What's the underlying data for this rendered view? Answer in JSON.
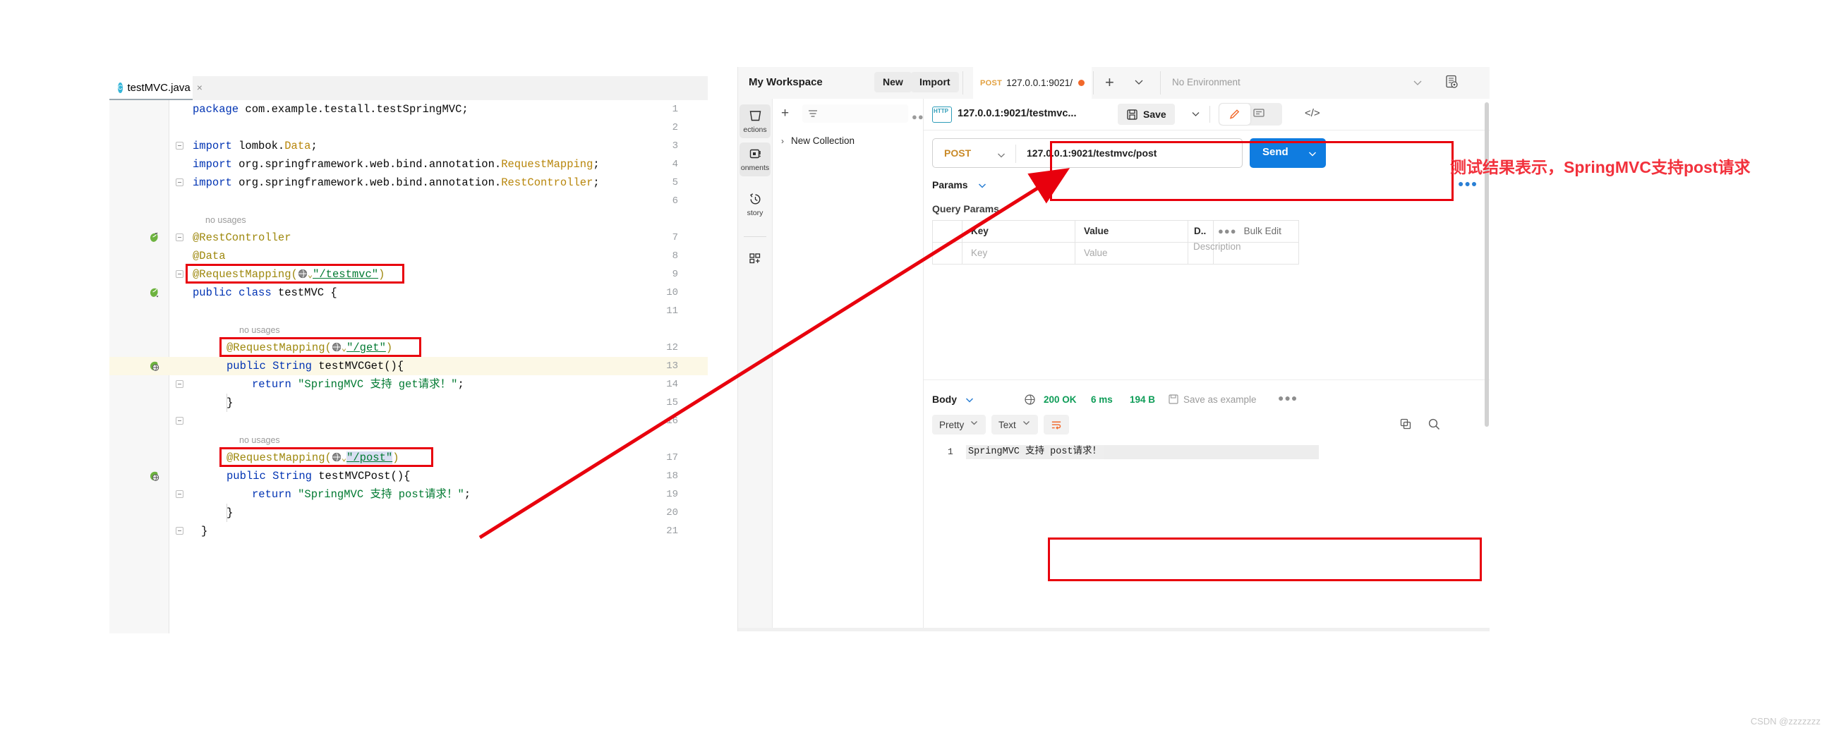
{
  "ide": {
    "tab": {
      "label": "testMVC.java",
      "icon": "java-class-icon",
      "close": "×"
    },
    "lines": [
      {
        "n": "1"
      },
      {
        "n": "2"
      },
      {
        "n": "3"
      },
      {
        "n": "4"
      },
      {
        "n": "5"
      },
      {
        "n": "6"
      },
      {
        "n": "7"
      },
      {
        "n": "8"
      },
      {
        "n": "9"
      },
      {
        "n": "10"
      },
      {
        "n": "11"
      },
      {
        "n": "12"
      },
      {
        "n": "13"
      },
      {
        "n": "14"
      },
      {
        "n": "15"
      },
      {
        "n": "16"
      },
      {
        "n": "17"
      },
      {
        "n": "18"
      },
      {
        "n": "19"
      },
      {
        "n": "20"
      },
      {
        "n": "21"
      }
    ],
    "code": {
      "l1_kw": "package",
      "l1_rest": " com.example.testall.testSpringMVC;",
      "l3_kw": "import",
      "l3_pkg": " lombok.",
      "l3_cls": "Data",
      "l3_end": ";",
      "l4_kw": "import",
      "l4_pkg": " org.springframework.web.bind.annotation.",
      "l4_cls": "RequestMapping",
      "l4_end": ";",
      "l5_kw": "import",
      "l5_pkg": " org.springframework.web.bind.annotation.",
      "l5_cls": "RestController",
      "l5_end": ";",
      "l7": "@RestController",
      "l8": "@Data",
      "l9_a": "@RequestMapping(",
      "l9_str": "\"/testmvc\"",
      "l9_b": ")",
      "l10_kw1": "public",
      "l10_kw2": "class",
      "l10_name": " testMVC {",
      "l12_a": "@RequestMapping(",
      "l12_str": "\"/get\"",
      "l12_b": ")",
      "l13_kw1": "public",
      "l13_kw2": "String",
      "l13_name": " testMVCGet(){",
      "l14_kw": "return",
      "l14_str": "\"SpringMVC 支持 get请求！\"",
      "l14_end": ";",
      "l15": "}",
      "l17_a": "@RequestMapping(",
      "l17_str": "\"/post\"",
      "l17_b": ")",
      "l18_kw1": "public",
      "l18_kw2": "String",
      "l18_name": " testMVCPost(){",
      "l19_kw": "return",
      "l19_str": "\"SpringMVC 支持 post请求！\"",
      "l19_end": ";",
      "l20": "}",
      "l21": "}",
      "no_usages": "no usages"
    }
  },
  "postman": {
    "workspace": "My Workspace",
    "new_button": "New",
    "import_button": "Import",
    "request_tab": {
      "method": "POST",
      "title": "127.0.0.1:9021/",
      "unsaved": true
    },
    "environment": "No Environment",
    "nav": [
      {
        "label": "ections",
        "icon": "collections-icon",
        "active": true
      },
      {
        "label": "onments",
        "icon": "environments-icon",
        "active": true
      },
      {
        "label": "story",
        "icon": "history-icon",
        "active": false
      },
      {
        "label": "",
        "icon": "new-module-icon",
        "active": false
      }
    ],
    "sidebar": {
      "collection": "New Collection",
      "chevron": "›"
    },
    "request": {
      "protocol_badge": "HTTP",
      "name": "127.0.0.1:9021/testmvc...",
      "save_label": "Save",
      "code_icon": "</>",
      "method": "POST",
      "url": "127.0.0.1:9021/testmvc/post",
      "send_label": "Send"
    },
    "params": {
      "tab_label": "Params",
      "section_label": "Query Params",
      "headers": [
        "",
        "Key",
        "Value",
        "D..",
        "Bulk Edit"
      ],
      "row_placeholders": [
        "",
        "Key",
        "Value",
        "Description"
      ]
    },
    "response": {
      "body_label": "Body",
      "status": "200 OK",
      "time": "6 ms",
      "size": "194 B",
      "save_as_example": "Save as example",
      "format": "Pretty",
      "type": "Text",
      "wrap_icon": "wrap-lines-icon",
      "line_number": "1",
      "body_text": "SpringMVC 支持 post请求！"
    }
  },
  "annotation": {
    "text": "测试结果表示，SpringMVC支持post请求",
    "color": "#f2313c",
    "box_color": "#e8000d"
  },
  "watermark": "CSDN @zzzzzzz"
}
